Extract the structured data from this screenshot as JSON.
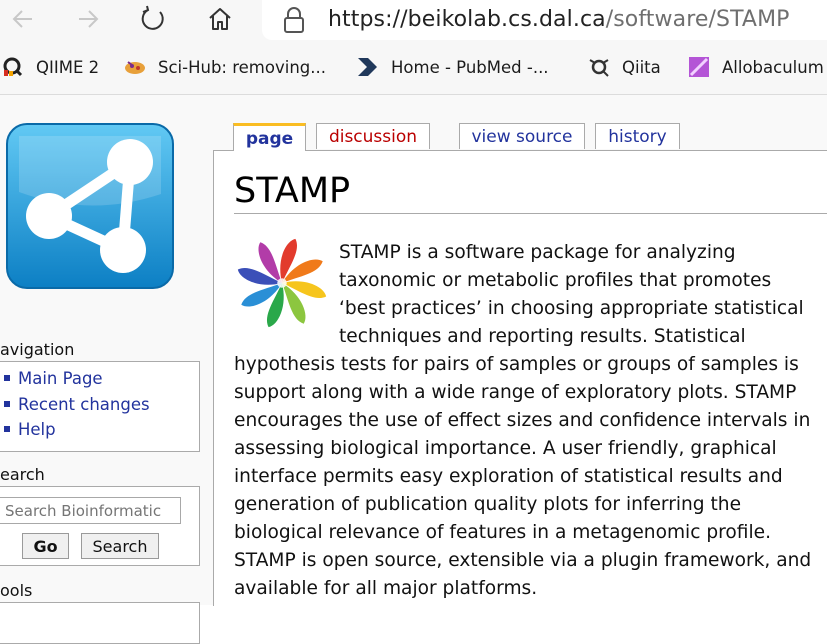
{
  "browser": {
    "url_host": "https://beikolab.cs.dal.ca",
    "url_path": "/software/STAMP",
    "icons": {
      "back": "arrow-left-icon",
      "forward": "arrow-right-icon",
      "refresh": "refresh-icon",
      "home": "home-icon",
      "lock": "lock-icon"
    },
    "bookmarks": [
      {
        "label": "QIIME 2",
        "icon": "qiime2-favicon"
      },
      {
        "label": "Sci-Hub: removing...",
        "icon": "scihub-favicon"
      },
      {
        "label": "Home - PubMed -...",
        "icon": "pubmed-favicon"
      },
      {
        "label": "Qiita",
        "icon": "qiita-favicon"
      },
      {
        "label": "Allobaculum",
        "icon": "allobaculum-favicon"
      }
    ]
  },
  "sidebar": {
    "navigation": {
      "title": "avigation",
      "items": [
        "Main Page",
        "Recent changes",
        "Help"
      ]
    },
    "search": {
      "title": "earch",
      "placeholder": "Search Bioinformatic",
      "go_label": "Go",
      "search_label": "Search"
    },
    "tools": {
      "title": "ools"
    }
  },
  "tabs": [
    {
      "label": "page",
      "selected": true
    },
    {
      "label": "discussion"
    },
    {
      "label": "view source"
    },
    {
      "label": "history"
    }
  ],
  "article": {
    "title": "STAMP",
    "body": "STAMP is a software package for analyzing taxonomic or metabolic profiles that promotes ‘best practices’ in choosing appropriate statistical techniques and reporting results. Statistical hypothesis tests for pairs of samples or groups of samples is support along with a wide range of exploratory plots. STAMP encourages the use of effect sizes and confidence intervals in assessing biological importance. A user friendly, graphical interface permits easy exploration of statistical results and generation of publication quality plots for inferring the biological relevance of features in a metagenomic profile. STAMP is open source, extensible via a plugin framework, and available for all major platforms."
  },
  "colors": {
    "link": "#22339d",
    "new_link": "#ba0000",
    "selected_tab_accent": "#fabd23",
    "logo_blue": "#1b9fdc"
  }
}
